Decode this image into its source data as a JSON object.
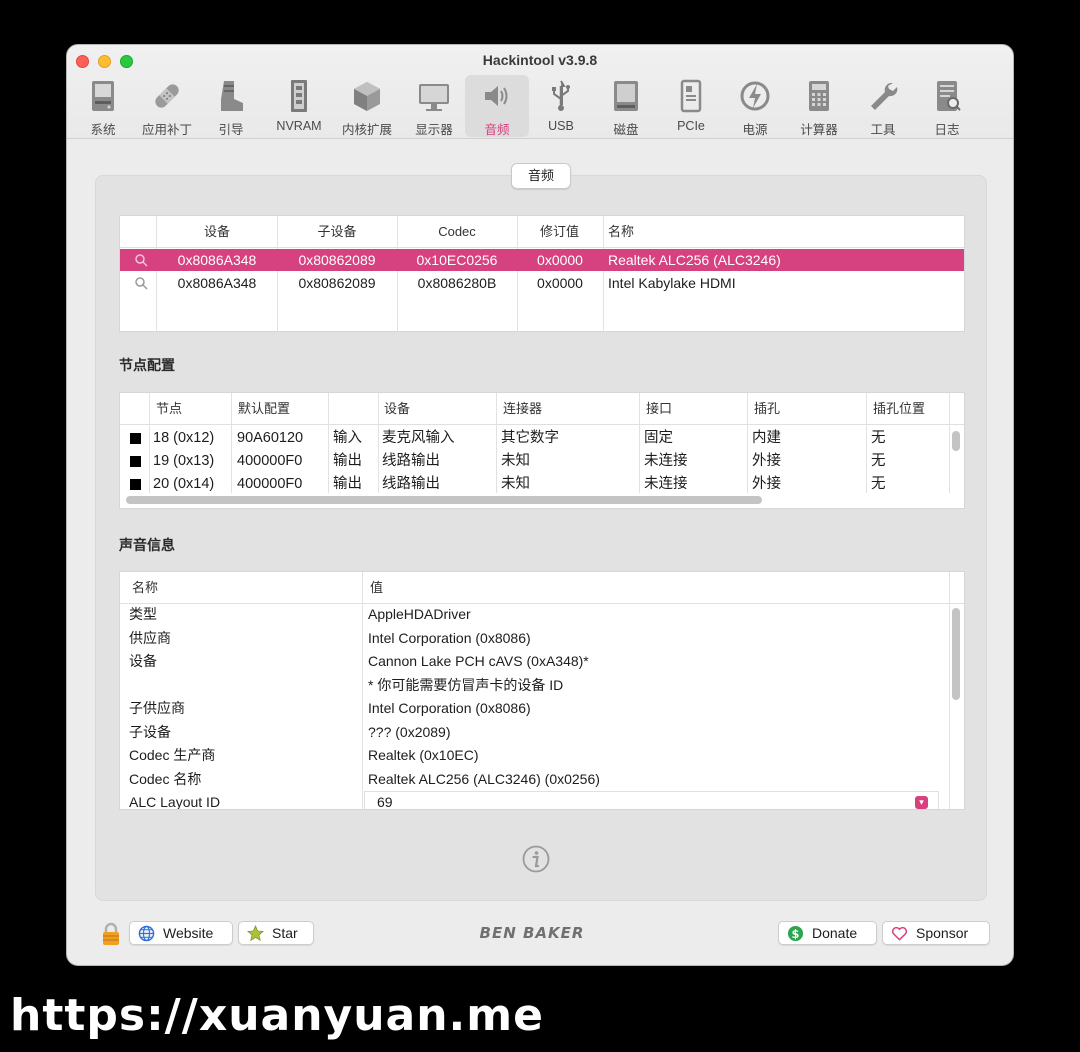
{
  "window": {
    "title": "Hackintool v3.9.8"
  },
  "toolbar": {
    "items": [
      {
        "label": "系统",
        "icon": "computer-icon"
      },
      {
        "label": "应用补丁",
        "icon": "bandage-icon"
      },
      {
        "label": "引导",
        "icon": "boot-icon"
      },
      {
        "label": "NVRAM",
        "icon": "memory-chip-icon"
      },
      {
        "label": "内核扩展",
        "icon": "cube-icon"
      },
      {
        "label": "显示器",
        "icon": "monitor-icon"
      },
      {
        "label": "音频",
        "icon": "speaker-icon"
      },
      {
        "label": "USB",
        "icon": "usb-icon"
      },
      {
        "label": "磁盘",
        "icon": "disk-icon"
      },
      {
        "label": "PCIe",
        "icon": "pcie-card-icon"
      },
      {
        "label": "电源",
        "icon": "power-icon"
      },
      {
        "label": "计算器",
        "icon": "calculator-icon"
      },
      {
        "label": "工具",
        "icon": "wrench-icon"
      },
      {
        "label": "日志",
        "icon": "log-icon"
      }
    ],
    "active": "音频"
  },
  "panel": {
    "tab_label": "音频"
  },
  "devices_table": {
    "headers": [
      "设备",
      "子设备",
      "Codec",
      "修订值",
      "名称"
    ],
    "rows": [
      {
        "device": "0x8086A348",
        "subdevice": "0x80862089",
        "codec": "0x10EC0256",
        "revision": "0x0000",
        "name": "Realtek ALC256 (ALC3246)",
        "selected": true
      },
      {
        "device": "0x8086A348",
        "subdevice": "0x80862089",
        "codec": "0x8086280B",
        "revision": "0x0000",
        "name": "Intel Kabylake HDMI",
        "selected": false
      }
    ]
  },
  "node_config": {
    "title": "节点配置",
    "headers": [
      "节点",
      "默认配置",
      "",
      "设备",
      "连接器",
      "接口",
      "插孔",
      "插孔位置"
    ],
    "rows": [
      {
        "node": "18 (0x12)",
        "default": "90A60120",
        "dir": "输入",
        "device": "麦克风输入",
        "connector": "其它数字",
        "port": "固定",
        "jack": "内建",
        "location": "无"
      },
      {
        "node": "19 (0x13)",
        "default": "400000F0",
        "dir": "输出",
        "device": "线路输出",
        "connector": "未知",
        "port": "未连接",
        "jack": "外接",
        "location": "无"
      },
      {
        "node": "20 (0x14)",
        "default": "400000F0",
        "dir": "输出",
        "device": "线路输出",
        "connector": "未知",
        "port": "未连接",
        "jack": "外接",
        "location": "无"
      }
    ]
  },
  "audio_info": {
    "title": "声音信息",
    "headers": [
      "名称",
      "值"
    ],
    "rows": [
      {
        "name": "类型",
        "value": "AppleHDADriver"
      },
      {
        "name": "供应商",
        "value": "Intel Corporation (0x8086)"
      },
      {
        "name": "设备",
        "value": "Cannon Lake PCH cAVS (0xA348)*"
      },
      {
        "name": "",
        "value": "* 你可能需要仿冒声卡的设备 ID"
      },
      {
        "name": "子供应商",
        "value": "Intel Corporation (0x8086)"
      },
      {
        "name": "子设备",
        "value": "??? (0x2089)"
      },
      {
        "name": "Codec 生产商",
        "value": "Realtek (0x10EC)"
      },
      {
        "name": "Codec 名称",
        "value": "Realtek ALC256 (ALC3246) (0x0256)"
      },
      {
        "name": "ALC Layout ID",
        "value": "69"
      }
    ]
  },
  "footer": {
    "website_label": "Website",
    "star_label": "Star",
    "brand": "BEN BAKER",
    "donate_label": "Donate",
    "sponsor_label": "Sponsor"
  },
  "watermark": "https://xuanyuan.me",
  "colors": {
    "accent": "#d6417f",
    "window_bg": "#ececec",
    "panel_bg": "#e2e2e2"
  }
}
